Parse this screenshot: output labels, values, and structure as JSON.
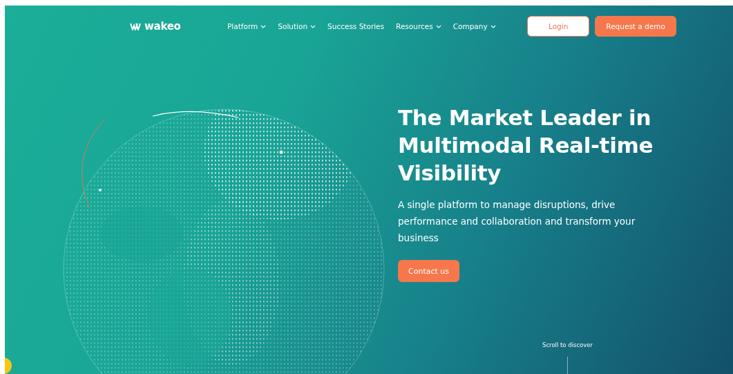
{
  "header": {
    "logo": "wakeo",
    "nav": [
      {
        "label": "Platform",
        "dropdown": true
      },
      {
        "label": "Solution",
        "dropdown": true
      },
      {
        "label": "Success Stories",
        "dropdown": false
      },
      {
        "label": "Resources",
        "dropdown": true
      },
      {
        "label": "Company",
        "dropdown": true
      }
    ],
    "buttons": [
      {
        "label": "Login",
        "kind": "outline"
      },
      {
        "label": "Request a demo",
        "kind": "filled"
      }
    ]
  },
  "hero": {
    "title": "The Market Leader in Multimodal Real-time Visibility",
    "subtitle": "A single platform to manage disruptions, drive performance and collaboration and transform your business",
    "cta": "Contact us",
    "scroll_hint": "Scroll to discover"
  }
}
